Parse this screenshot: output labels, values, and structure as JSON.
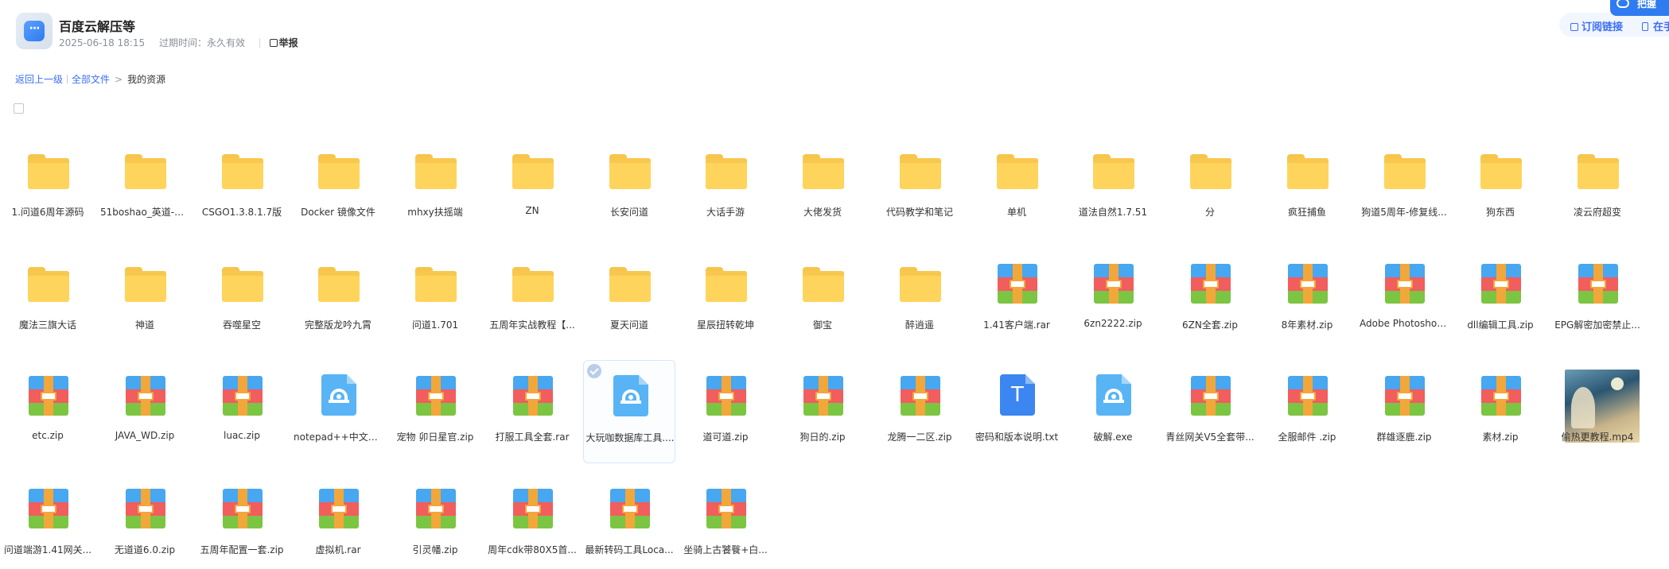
{
  "header": {
    "title": "百度云解压等",
    "date": "2025-06-18 18:15",
    "expire_label": "过期时间：永久有效",
    "report_label": "举报",
    "subscribe_label": "订阅链接",
    "phone_label": "在手",
    "save_label": "把握"
  },
  "breadcrumb": {
    "back": "返回上一级",
    "all_files": "全部文件",
    "current": "我的资源"
  },
  "colors": {
    "accent": "#3b6ff5",
    "folder": "#ffd45c"
  },
  "files": [
    {
      "name": "1.问道6周年源码",
      "type": "folder"
    },
    {
      "name": "51boshao_英道-奖励...",
      "type": "folder"
    },
    {
      "name": "CSGO1.3.8.1.7版",
      "type": "folder"
    },
    {
      "name": "Docker 镜像文件",
      "type": "folder"
    },
    {
      "name": "mhxy扶摇端",
      "type": "folder"
    },
    {
      "name": "ZN",
      "type": "folder"
    },
    {
      "name": "长安问道",
      "type": "folder"
    },
    {
      "name": "大话手游",
      "type": "folder"
    },
    {
      "name": "大佬发货",
      "type": "folder"
    },
    {
      "name": "代码教学和笔记",
      "type": "folder"
    },
    {
      "name": "单机",
      "type": "folder"
    },
    {
      "name": "道法自然1.7.51",
      "type": "folder"
    },
    {
      "name": "分",
      "type": "folder"
    },
    {
      "name": "疯狂捕鱼",
      "type": "folder"
    },
    {
      "name": "狗道5周年-修复线...",
      "type": "folder"
    },
    {
      "name": "狗东西",
      "type": "folder"
    },
    {
      "name": "凌云府超变",
      "type": "folder"
    },
    {
      "name": "魔法三旗大话",
      "type": "folder"
    },
    {
      "name": "神道",
      "type": "folder"
    },
    {
      "name": "吞噬星空",
      "type": "folder"
    },
    {
      "name": "完整版龙吟九霄",
      "type": "folder"
    },
    {
      "name": "问道1.701",
      "type": "folder"
    },
    {
      "name": "五周年实战教程【...",
      "type": "folder"
    },
    {
      "name": "夏天问道",
      "type": "folder"
    },
    {
      "name": "星辰扭转乾坤",
      "type": "folder"
    },
    {
      "name": "御宝",
      "type": "folder"
    },
    {
      "name": "醉逍遥",
      "type": "folder"
    },
    {
      "name": "1.41客户端.rar",
      "type": "archive"
    },
    {
      "name": "6zn2222.zip",
      "type": "archive"
    },
    {
      "name": "6ZN全套.zip",
      "type": "archive"
    },
    {
      "name": "8年素材.zip",
      "type": "archive"
    },
    {
      "name": "Adobe Photoshop ...",
      "type": "archive"
    },
    {
      "name": "dll编辑工具.zip",
      "type": "archive"
    },
    {
      "name": "EPG解密加密禁止...",
      "type": "archive"
    },
    {
      "name": "etc.zip",
      "type": "archive"
    },
    {
      "name": "JAVA_WD.zip",
      "type": "archive"
    },
    {
      "name": "luac.zip",
      "type": "archive"
    },
    {
      "name": "notepad++中文版(...",
      "type": "exe"
    },
    {
      "name": "宠物 卯日星官.zip",
      "type": "archive"
    },
    {
      "name": "打服工具全套.rar",
      "type": "archive"
    },
    {
      "name": "大玩咖数据库工具....",
      "type": "exe",
      "selected": true
    },
    {
      "name": "道可道.zip",
      "type": "archive"
    },
    {
      "name": "狗日的.zip",
      "type": "archive"
    },
    {
      "name": "龙腾一二区.zip",
      "type": "archive"
    },
    {
      "name": "密码和版本说明.txt",
      "type": "txt"
    },
    {
      "name": "破解.exe",
      "type": "exe"
    },
    {
      "name": "青丝网关V5全套带...",
      "type": "archive"
    },
    {
      "name": "全服邮件 .zip",
      "type": "archive"
    },
    {
      "name": "群雄逐鹿.zip",
      "type": "archive"
    },
    {
      "name": "素材.zip",
      "type": "archive"
    },
    {
      "name": "偷热更教程.mp4",
      "type": "video"
    },
    {
      "name": "问道端游1.41网关...",
      "type": "archive"
    },
    {
      "name": "无道道6.0.zip",
      "type": "archive"
    },
    {
      "name": "五周年配置一套.zip",
      "type": "archive"
    },
    {
      "name": "虚拟机.rar",
      "type": "archive"
    },
    {
      "name": "引灵幡.zip",
      "type": "archive"
    },
    {
      "name": "周年cdk带80X5首...",
      "type": "archive"
    },
    {
      "name": "最新转码工具Loca...",
      "type": "archive"
    },
    {
      "name": "坐骑上古饕餮+白...",
      "type": "archive"
    }
  ]
}
